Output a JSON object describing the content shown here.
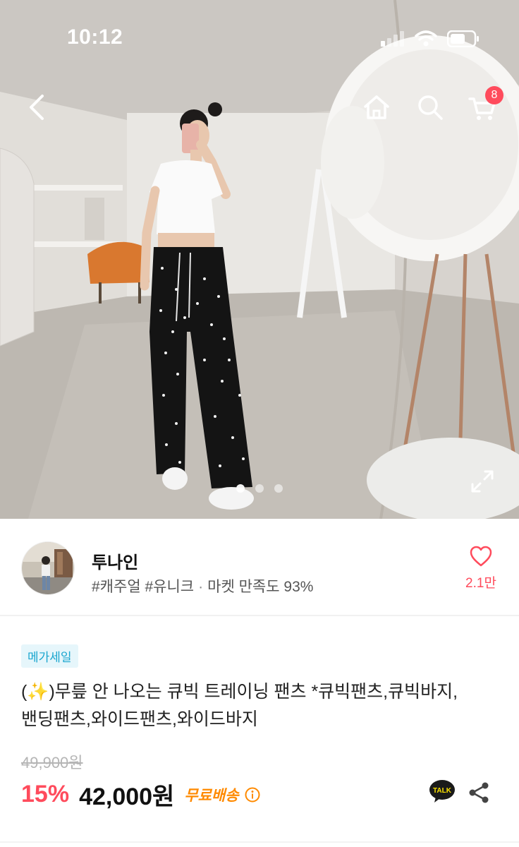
{
  "status_bar": {
    "time": "10:12"
  },
  "top_nav": {
    "cart_count": "8"
  },
  "gallery": {
    "total_images": 3,
    "active_index": 1
  },
  "shop": {
    "name": "투나인",
    "tags": "#캐주얼 #유니크",
    "satisfaction": "마켓 만족도 93%",
    "likes": "2.1만"
  },
  "product": {
    "badge": "메가세일",
    "title": "(✨)무릎 안 나오는 큐빅 트레이닝 팬츠   *큐빅팬츠,큐빅바지,밴딩팬츠,와이드팬츠,와이드바지",
    "original_price": "49,900원",
    "discount": "15%",
    "price": "42,000원",
    "shipping": "무료배송"
  },
  "icons": {
    "back": "back-arrow-icon",
    "home": "home-icon",
    "search": "search-icon",
    "cart": "cart-icon",
    "expand": "expand-icon",
    "heart": "heart-icon",
    "info": "info-icon",
    "talk": "kakao-talk-icon",
    "share": "share-icon"
  },
  "colors": {
    "accent_red": "#ff4b5c",
    "shipping_orange": "#ff8a00",
    "tag_blue": "#1aa6cf"
  }
}
